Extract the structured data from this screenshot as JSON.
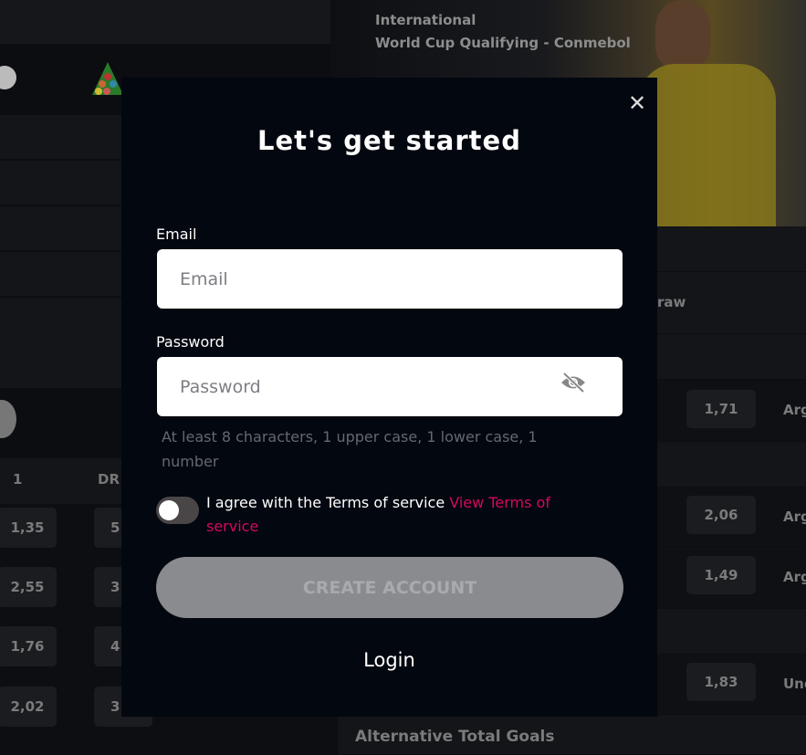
{
  "background": {
    "event_category": "International",
    "event_name": "World Cup Qualifying - Conmebol",
    "draw_header": "raw",
    "left_headers": [
      "1",
      "DR"
    ],
    "left_odds": [
      [
        "1,35",
        "5"
      ],
      [
        "2,55",
        "3"
      ],
      [
        "1,76",
        "4"
      ],
      [
        "2,02",
        "3"
      ]
    ],
    "right_odds": [
      {
        "odd": "1,71",
        "label": "Arg"
      },
      {
        "odd": "2,06",
        "label": "Arg"
      },
      {
        "odd": "1,49",
        "label": "Arg"
      },
      {
        "odd": "1,83",
        "label": "Und"
      }
    ],
    "section_title": "Alternative Total Goals"
  },
  "modal": {
    "title": "Let's get started",
    "email_label": "Email",
    "email_placeholder": "Email",
    "email_value": "",
    "password_label": "Password",
    "password_placeholder": "Password",
    "password_value": "",
    "password_hint": "At least 8 characters, 1 upper case, 1 lower case, 1 number",
    "terms_toggle_on": false,
    "agree_text": "I agree with the Terms of service",
    "terms_link": "View Terms of service",
    "create_label": "CREATE ACCOUNT",
    "login_label": "Login",
    "link_color": "#d4095d"
  }
}
